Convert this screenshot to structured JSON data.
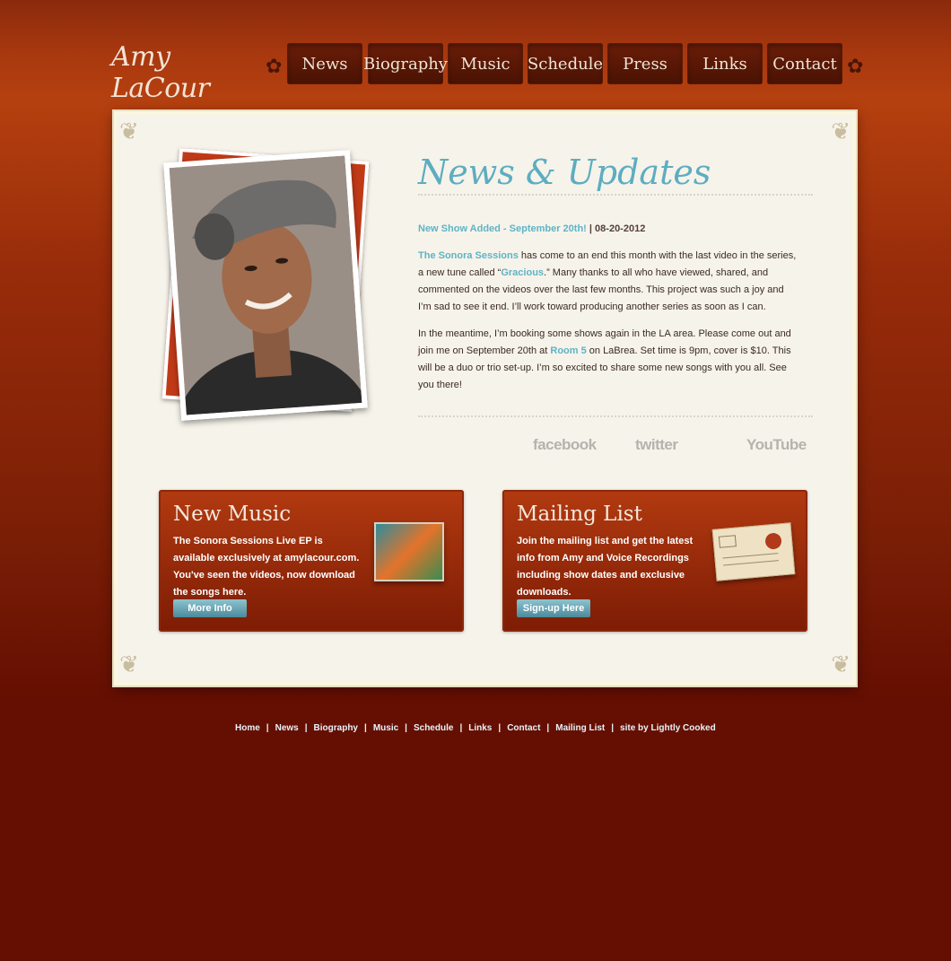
{
  "logo": {
    "text": "Amy LaCour"
  },
  "nav": {
    "items": [
      "News",
      "Biography",
      "Music",
      "Schedule",
      "Press",
      "Links",
      "Contact"
    ]
  },
  "news": {
    "title": "News & Updates",
    "post_title": "New Show Added - September 20th!",
    "post_sep": " | ",
    "post_date": "08-20-2012",
    "p1": {
      "link1": "The Sonora Sessions",
      "text1": " has come to an end this month with the last video in the series, a new tune called “",
      "link2": "Gracious",
      "text2": ".”  Many thanks to all who have viewed, shared, and commented on the videos over the last few months.  This project was such a joy and I’m sad to see it end.  I’ll work toward producing another series as soon as I can."
    },
    "p2": {
      "text1": "In the meantime, I’m booking some shows again in the LA area.  Please come out and join me on September 20th at ",
      "link": "Room 5",
      "text2": " on LaBrea.  Set time is 9pm, cover is $10.  This will be a duo or trio set-up.  I’m so excited to share some new songs with you all.  See you there!"
    }
  },
  "social": {
    "facebook": "facebook",
    "twitter": "twitter",
    "youtube": "YouTube"
  },
  "promos": {
    "music": {
      "title": "New Music",
      "text": "The Sonora Sessions Live EP is available exclusively at amylacour.com. You've seen the videos, now download the songs here.",
      "button": "More Info"
    },
    "mailing": {
      "title": "Mailing List",
      "text": "Join the mailing list and get the latest info from Amy and Voice Recordings including show dates and exclusive downloads.",
      "button": "Sign-up Here"
    }
  },
  "footer": {
    "links": [
      "Home",
      "News",
      "Biography",
      "Music",
      "Schedule",
      "Links",
      "Contact",
      "Mailing List",
      "site by Lightly Cooked"
    ],
    "separator": "|"
  }
}
